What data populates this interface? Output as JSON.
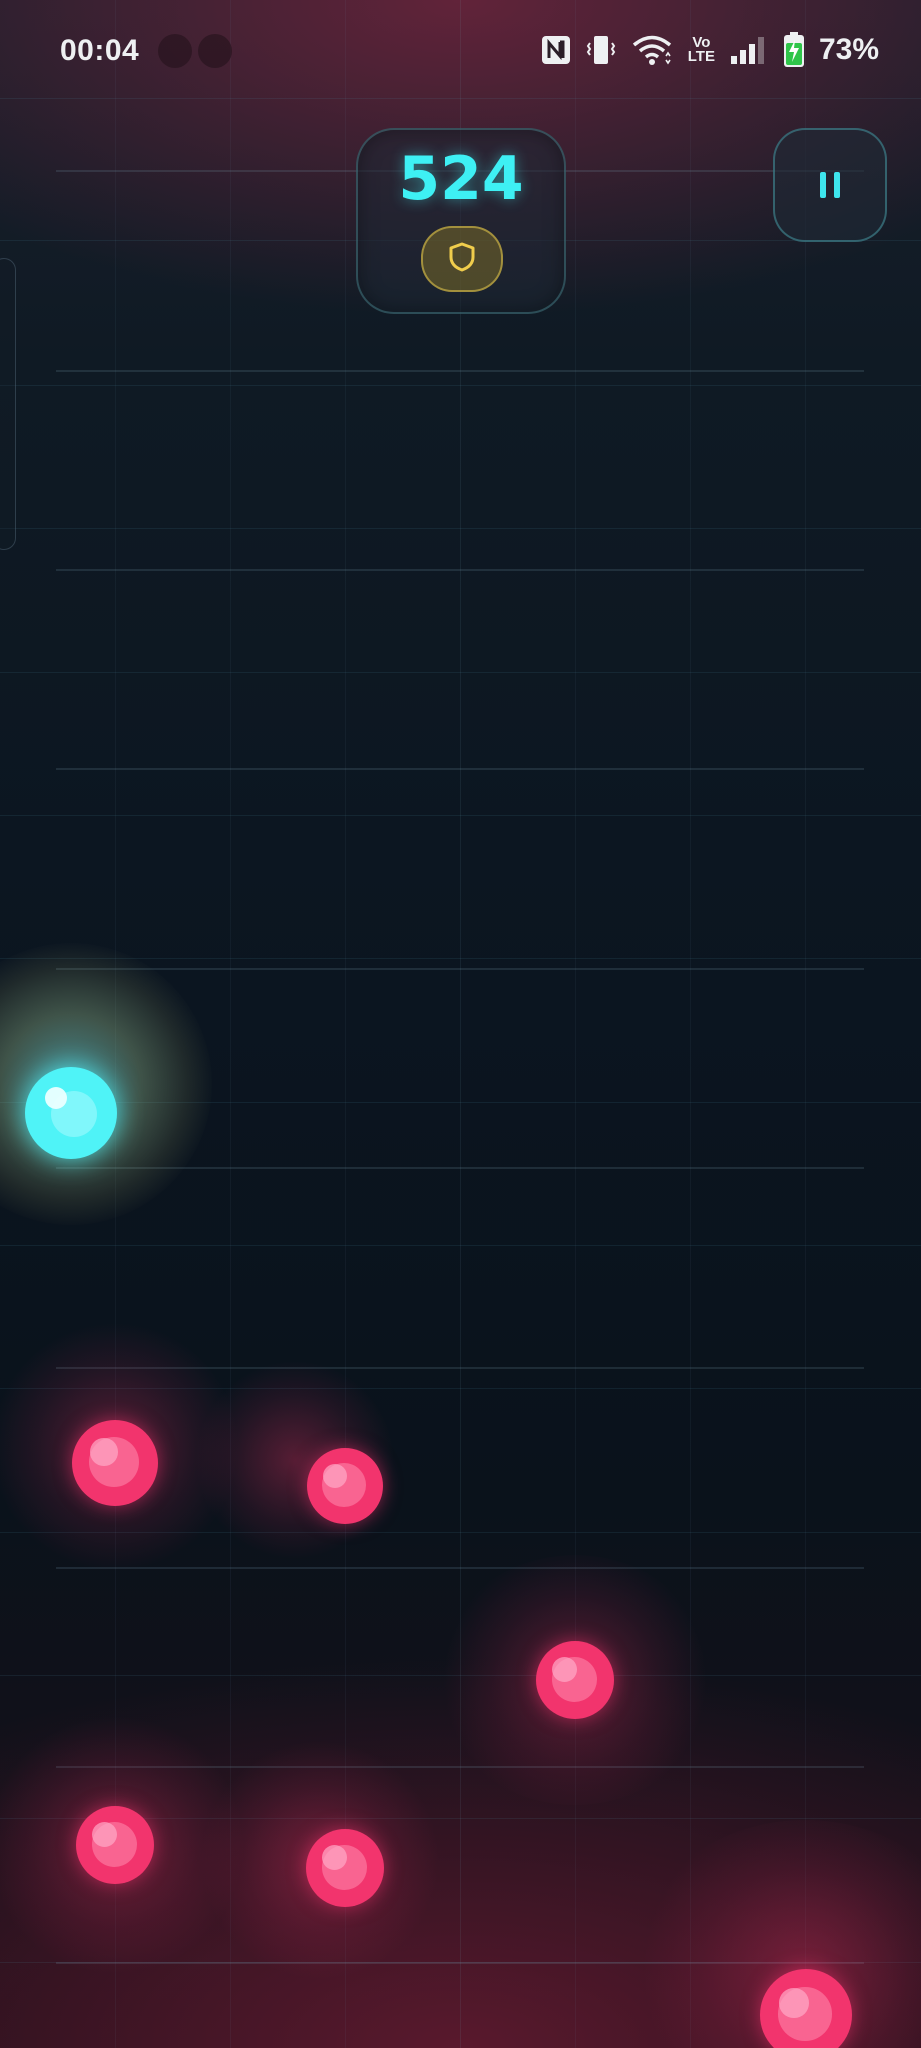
{
  "status_bar": {
    "time": "00:04",
    "network_label": "Vo\nLTE",
    "battery_percent": "73%",
    "battery_charging": true,
    "icons": [
      "nfc-icon",
      "vibrate-icon",
      "wifi-icon",
      "volte-icon",
      "signal-icon",
      "battery-charging-icon"
    ]
  },
  "hud": {
    "score": "524",
    "powerup_icon": "shield-icon",
    "pause_icon": "pause-icon"
  },
  "game": {
    "player": {
      "color": "#4ff3f7"
    },
    "enemy_color": "#f2346d",
    "enemy_count": 6
  },
  "colors": {
    "accent_cyan": "#3ef0f4",
    "shield_gold": "#e8c34a",
    "enemy_pink": "#f2346d"
  }
}
